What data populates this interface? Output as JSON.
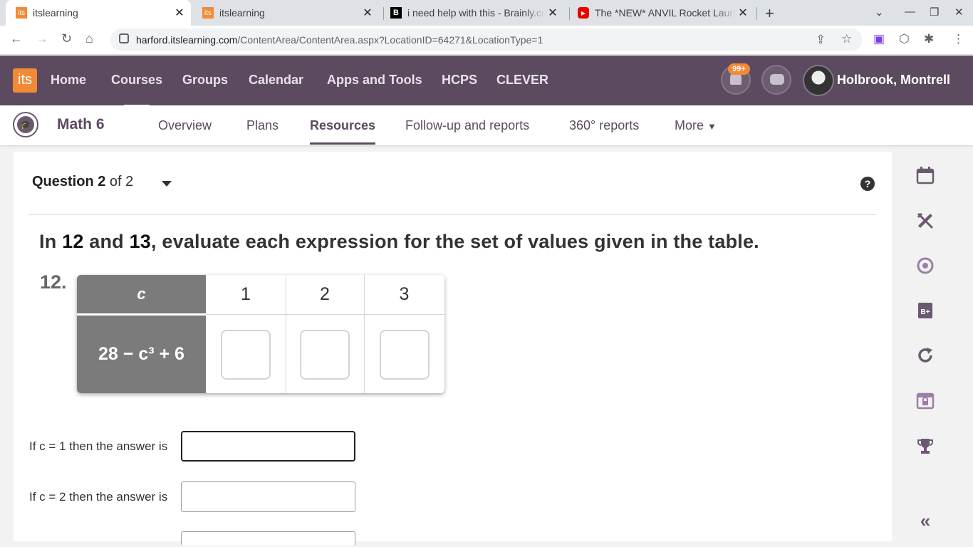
{
  "browser": {
    "tabs": [
      {
        "title": "itslearning",
        "favicon": "its",
        "active": true
      },
      {
        "title": "itslearning",
        "favicon": "its",
        "active": false
      },
      {
        "title": "i need help with this - Brainly.com",
        "favicon": "B",
        "active": false
      },
      {
        "title": "The *NEW* ANVIL Rocket Launcher",
        "favicon": "youtube",
        "active": false
      }
    ],
    "url_host": "harford.itslearning.com",
    "url_path": "/ContentArea/ContentArea.aspx?LocationID=64271&LocationType=1"
  },
  "header": {
    "logo": "its",
    "nav": [
      "Home",
      "Courses",
      "Groups",
      "Calendar",
      "Apps and Tools",
      "HCPS",
      "CLEVER"
    ],
    "notifications_badge": "99+",
    "user_name": "Holbrook, Montrell"
  },
  "course": {
    "title": "Math 6",
    "tabs": [
      "Overview",
      "Plans",
      "Resources",
      "Follow-up and reports",
      "360° reports",
      "More"
    ],
    "active_tab": "Resources"
  },
  "question": {
    "label": "Question",
    "number": "2",
    "of_text": "of 2",
    "instruction_pre": "In ",
    "instruction_n1": "12",
    "instruction_mid": " and ",
    "instruction_n2": "13",
    "instruction_post": ", evaluate each expression for the set of values given in the table.",
    "item_number": "12.",
    "table": {
      "var_header": "c",
      "values": [
        "1",
        "2",
        "3"
      ],
      "expression": "28 − c³ + 6"
    },
    "answers": [
      {
        "prompt": "If c = 1 then the answer is",
        "value": ""
      },
      {
        "prompt": "If c = 2 then the answer is",
        "value": ""
      }
    ]
  },
  "rail_icons": [
    "calendar-icon",
    "tools-icon",
    "target-icon",
    "grade-book-icon",
    "refresh-icon",
    "locked-page-icon",
    "trophy-icon",
    "collapse-icon"
  ]
}
